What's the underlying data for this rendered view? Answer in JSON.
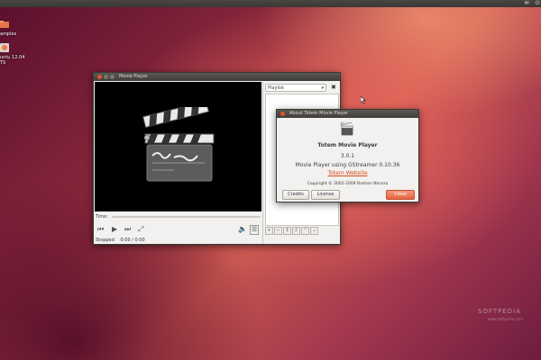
{
  "desktop": {
    "icons": [
      {
        "label": "amples",
        "icon": "folder-icon"
      },
      {
        "label": "untu 12.04\nTS",
        "icon": "disc-icon"
      }
    ],
    "watermark": "SOFTPEDIA",
    "watermark_sub": "www.softpedia.com"
  },
  "top_panel": {
    "icons": [
      "mail-icon",
      "power-icon"
    ]
  },
  "movie_player": {
    "title": "Movie Player",
    "time_label": "Time:",
    "status": "Stopped",
    "time_display": "0:00 / 0:00",
    "playlist": {
      "combo_value": "Playlist",
      "toolbar": [
        "+",
        "−",
        "↕",
        "⇩",
        "⌃",
        "⌄"
      ]
    }
  },
  "about_dialog": {
    "title": "About Totem Movie Player",
    "app_name": "Totem Movie Player",
    "version": "3.0.1",
    "description": "Movie Player using GStreamer 0.10.36",
    "website_link": "Totem Website",
    "copyright": "Copyright © 2002-2009 Bastien Nocera",
    "buttons": {
      "credits": "Credits",
      "license": "License",
      "close": "Close"
    }
  },
  "colors": {
    "accent": "#e5633f",
    "link": "#dd4814",
    "titlebar": "#3f3e3a"
  }
}
